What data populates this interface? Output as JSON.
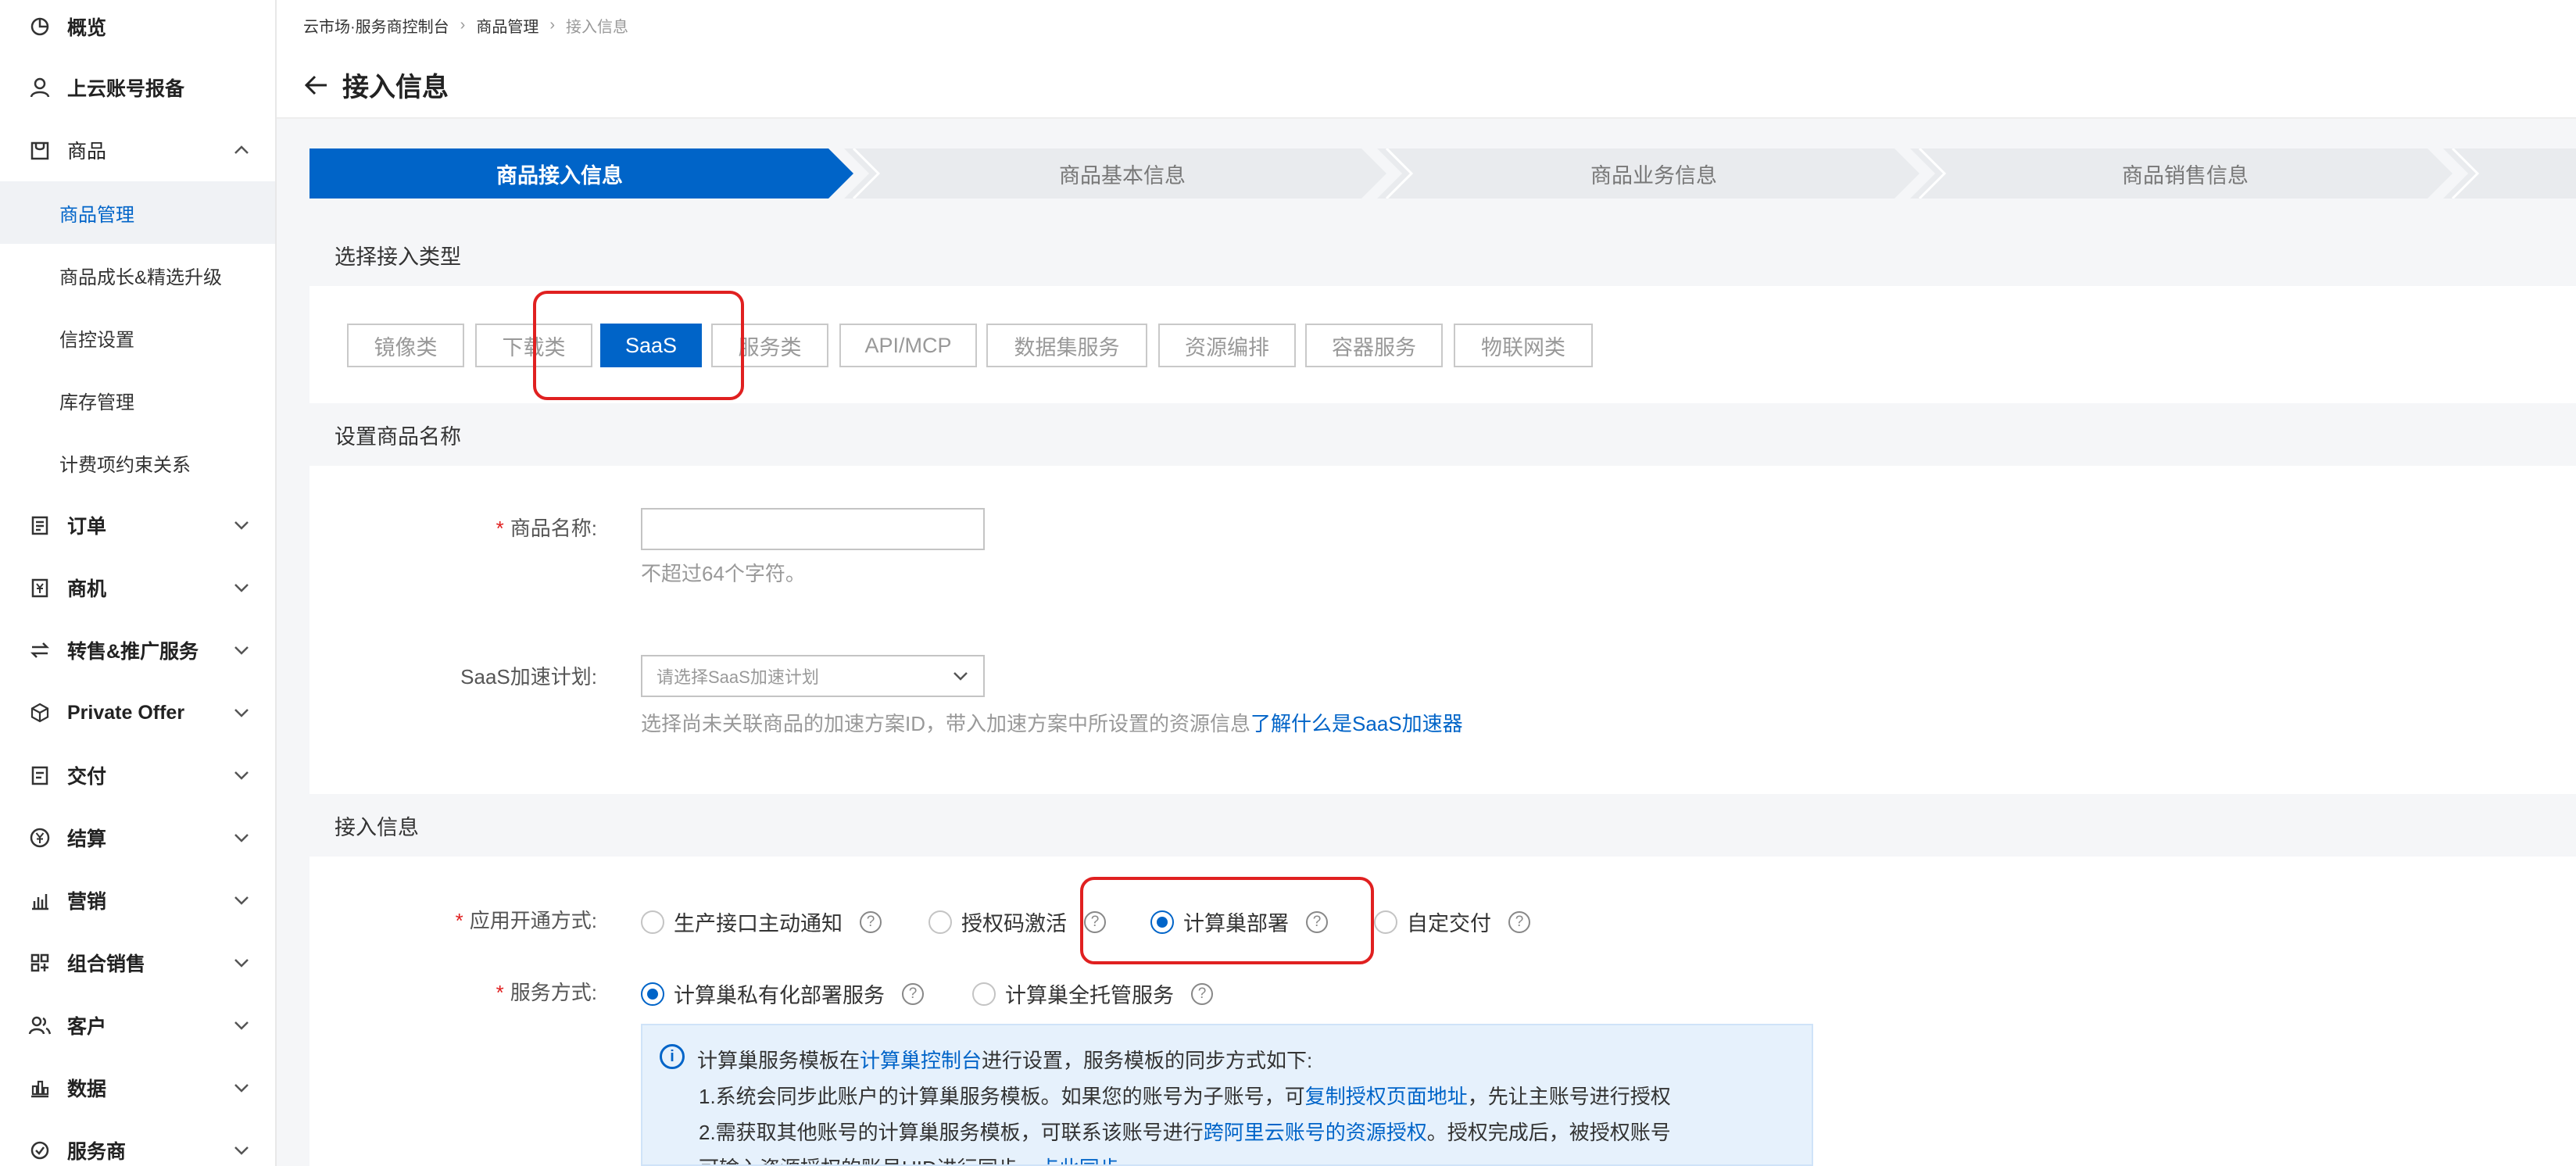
{
  "sidebar": {
    "overview": "概览",
    "cloud_account": "上云账号报备",
    "product": "商品",
    "product_sub": [
      "商品管理",
      "商品成长&精选升级",
      "信控设置",
      "库存管理",
      "计费项约束关系"
    ],
    "groups": [
      "订单",
      "商机",
      "转售&推广服务",
      "Private Offer",
      "交付",
      "结算",
      "营销",
      "组合销售",
      "客户",
      "数据",
      "服务商"
    ]
  },
  "breadcrumb": {
    "root": "云市场·服务商控制台",
    "parent": "商品管理",
    "current": "接入信息"
  },
  "page_title": "接入信息",
  "steps": [
    "商品接入信息",
    "商品基本信息",
    "商品业务信息",
    "商品销售信息"
  ],
  "colors": {
    "primary": "#0064c8",
    "highlight": "#e02020"
  },
  "type_section": {
    "title": "选择接入类型",
    "types": [
      "镜像类",
      "下载类",
      "SaaS",
      "服务类",
      "API/MCP",
      "数据集服务",
      "资源编排",
      "容器服务",
      "物联网类"
    ],
    "selected": "SaaS"
  },
  "name_section": {
    "title": "设置商品名称",
    "name_label": "商品名称:",
    "name_value": "",
    "name_hint": "不超过64个字符。",
    "accel_label": "SaaS加速计划:",
    "accel_placeholder": "请选择SaaS加速计划",
    "accel_hint": "选择尚未关联商品的加速方案ID，带入加速方案中所设置的资源信息",
    "accel_link": "了解什么是SaaS加速器"
  },
  "access_section": {
    "title": "接入信息",
    "open_label": "应用开通方式:",
    "open_options": [
      "生产接口主动通知",
      "授权码激活",
      "计算巢部署",
      "自定交付"
    ],
    "open_selected": "计算巢部署",
    "service_label": "服务方式:",
    "service_options": [
      "计算巢私有化部署服务",
      "计算巢全托管服务"
    ],
    "service_selected": "计算巢私有化部署服务"
  },
  "notice": {
    "line1_a": "计算巢服务模板在",
    "line1_link": "计算巢控制台",
    "line1_b": "进行设置，服务模板的同步方式如下:",
    "line2_a": "1.系统会同步此账户的计算巢服务模板。如果您的账号为子账号，可",
    "line2_link": "复制授权页面地址",
    "line2_b": "，先让主账号进行授权",
    "line3_a": "2.需获取其他账号的计算巢服务模板，可联系该账号进行",
    "line3_link": "跨阿里云账号的资源授权",
    "line3_b": "。授权完成后，被授权账号",
    "line4_a": "可输入资源授权的账号UID进行同步，",
    "line4_link": "点此同步"
  }
}
